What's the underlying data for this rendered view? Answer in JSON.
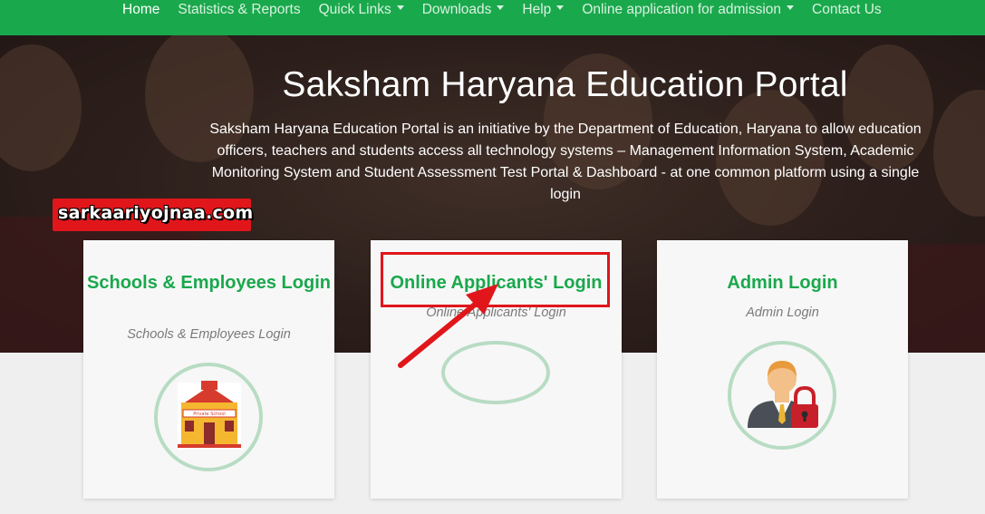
{
  "nav": {
    "items": [
      {
        "label": "Home",
        "active": true,
        "dropdown": false
      },
      {
        "label": "Statistics & Reports",
        "active": false,
        "dropdown": false
      },
      {
        "label": "Quick Links",
        "active": false,
        "dropdown": true
      },
      {
        "label": "Downloads",
        "active": false,
        "dropdown": true
      },
      {
        "label": "Help",
        "active": false,
        "dropdown": true
      },
      {
        "label": "Online application for admission",
        "active": false,
        "dropdown": true
      },
      {
        "label": "Contact Us",
        "active": false,
        "dropdown": false
      }
    ]
  },
  "hero": {
    "title": "Saksham Haryana Education Portal",
    "description": "Saksham Haryana Education Portal is an initiative by the Department of Education, Haryana to allow education officers, teachers and students access all technology systems – Management Information System, Academic Monitoring System and Student Assessment Test Portal & Dashboard - at one common platform using a single login"
  },
  "watermark": {
    "text": "sarkaariyojnaa.com"
  },
  "cards": [
    {
      "title": "Schools & Employees Login",
      "subtitle": "Schools & Employees Login",
      "icon": "school-building-icon"
    },
    {
      "title": "Online Applicants' Login",
      "subtitle": "Online Applicants' Login",
      "icon": "empty-icon"
    },
    {
      "title": "Admin Login",
      "subtitle": "Admin Login",
      "icon": "admin-lock-icon"
    }
  ],
  "colors": {
    "nav_bg": "#1aa84c",
    "accent_green": "#1aa84c",
    "annotation_red": "#e0161b",
    "circle_border": "#b7dcc3"
  },
  "school_sign": "Private School"
}
